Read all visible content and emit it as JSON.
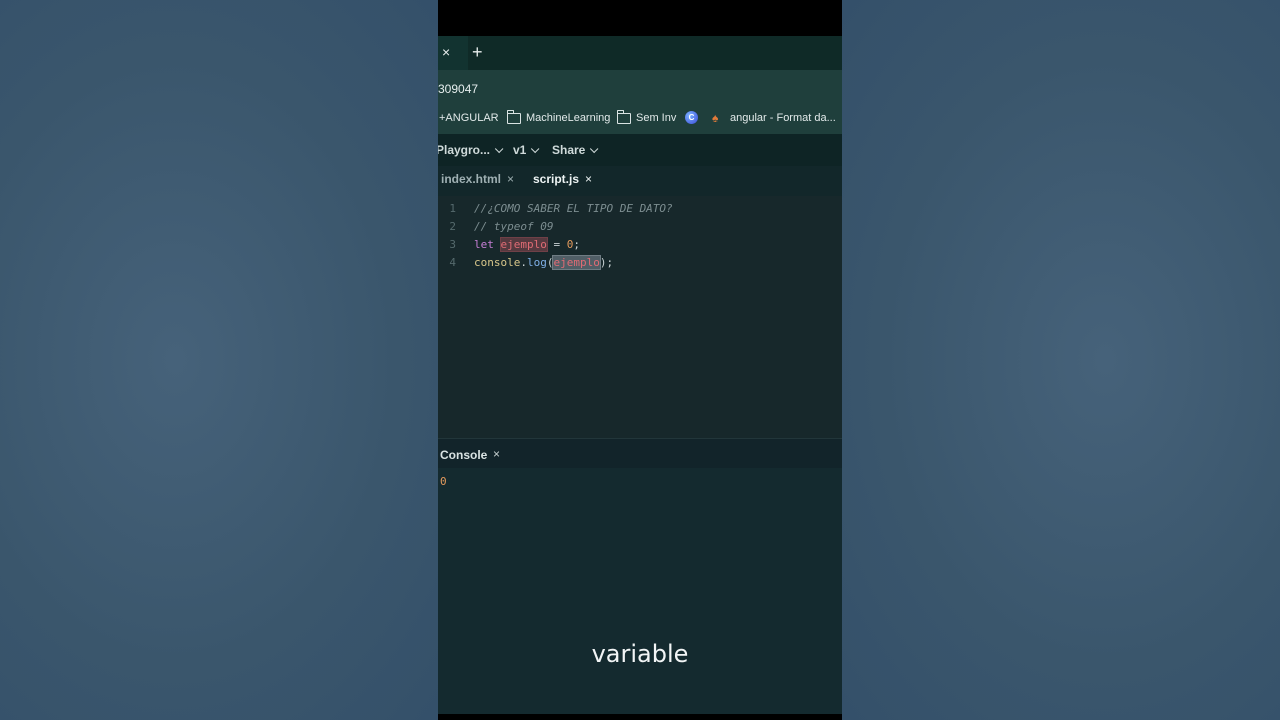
{
  "browser": {
    "tab_close": "×",
    "new_tab": "+",
    "url": "309047"
  },
  "bookmarks": [
    {
      "label": "+ANGULAR"
    },
    {
      "label": "MachineLearning"
    },
    {
      "label": "Sem Inv"
    },
    {
      "label": "angular - Format da..."
    }
  ],
  "editor_menu": {
    "playground": "Playgro...",
    "version": "v1",
    "share": "Share"
  },
  "file_tabs": [
    {
      "label": "index.html",
      "close": "×"
    },
    {
      "label": "script.js",
      "close": "×"
    }
  ],
  "code": {
    "lines": [
      {
        "n": "1",
        "text": "//¿COMO SABER EL TIPO DE DATO?"
      },
      {
        "n": "2",
        "text": "// typeof 09"
      },
      {
        "n": "3",
        "kw": "let",
        "var": "ejemplo",
        "rest": " = ",
        "num": "0",
        "end": ";"
      },
      {
        "n": "4",
        "obj": "console",
        "dot": ".",
        "meth": "log",
        "open": "(",
        "arg": "ejemplo",
        "close": ");"
      }
    ]
  },
  "console": {
    "title": "Console",
    "close": "×",
    "output": "0"
  },
  "subtitle": "variable"
}
